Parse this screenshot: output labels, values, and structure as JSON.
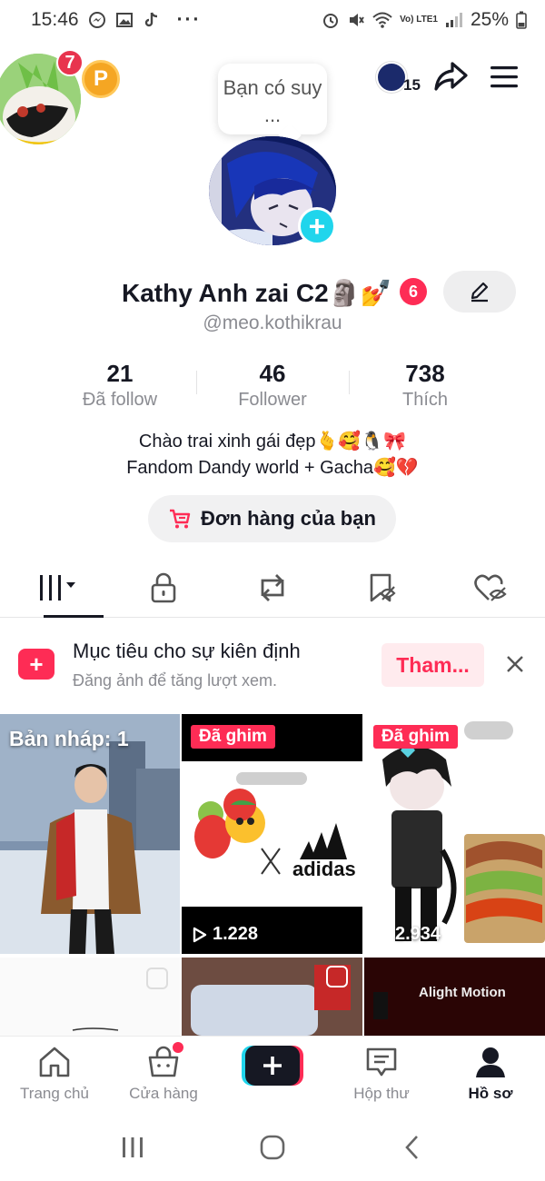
{
  "status_bar": {
    "time": "15:46",
    "battery": "25%",
    "signal_label": "Vo) LTE1"
  },
  "header": {
    "story_badge_count": "7",
    "points_badge": "P",
    "tooltip_text": "Bạn có suy ...",
    "friends_count": "15"
  },
  "profile": {
    "display_name": "Kathy Anh zai C2🗿💅",
    "name_badge": "6",
    "username": "@meo.kothikrau",
    "stats": [
      {
        "value": "21",
        "label": "Đã follow"
      },
      {
        "value": "46",
        "label": "Follower"
      },
      {
        "value": "738",
        "label": "Thích"
      }
    ],
    "bio_line1": "Chào trai xinh gái đẹp🫰🥰🐧🎀",
    "bio_line2": "Fandom Dandy world + Gacha🥰💔",
    "orders_label": "Đơn hàng của bạn"
  },
  "tabs": [
    "videos-icon",
    "lock-icon",
    "repost-icon",
    "favorites-icon",
    "liked-icon"
  ],
  "prompt": {
    "title": "Mục tiêu cho sự kiên định",
    "subtitle": "Đăng ảnh để tăng lượt xem.",
    "join_label": "Tham..."
  },
  "grid": {
    "draft_label": "Bản nháp: 1",
    "pinned_label": "Đã ghim",
    "tile1_views": "1.228",
    "tile2_views": "2.934",
    "brand_text": "adidas",
    "watermark_text": "Alight Motion"
  },
  "bottom_nav": [
    {
      "label": "Trang chủ",
      "icon": "home-icon"
    },
    {
      "label": "Cửa hàng",
      "icon": "shop-icon"
    },
    {
      "label": "",
      "icon": "create-icon"
    },
    {
      "label": "Hộp thư",
      "icon": "inbox-icon"
    },
    {
      "label": "Hồ sơ",
      "icon": "profile-icon"
    }
  ],
  "colors": {
    "accent": "#fe2c55",
    "cyan": "#20d5ec",
    "text": "#161823",
    "muted": "#8a8b91"
  }
}
